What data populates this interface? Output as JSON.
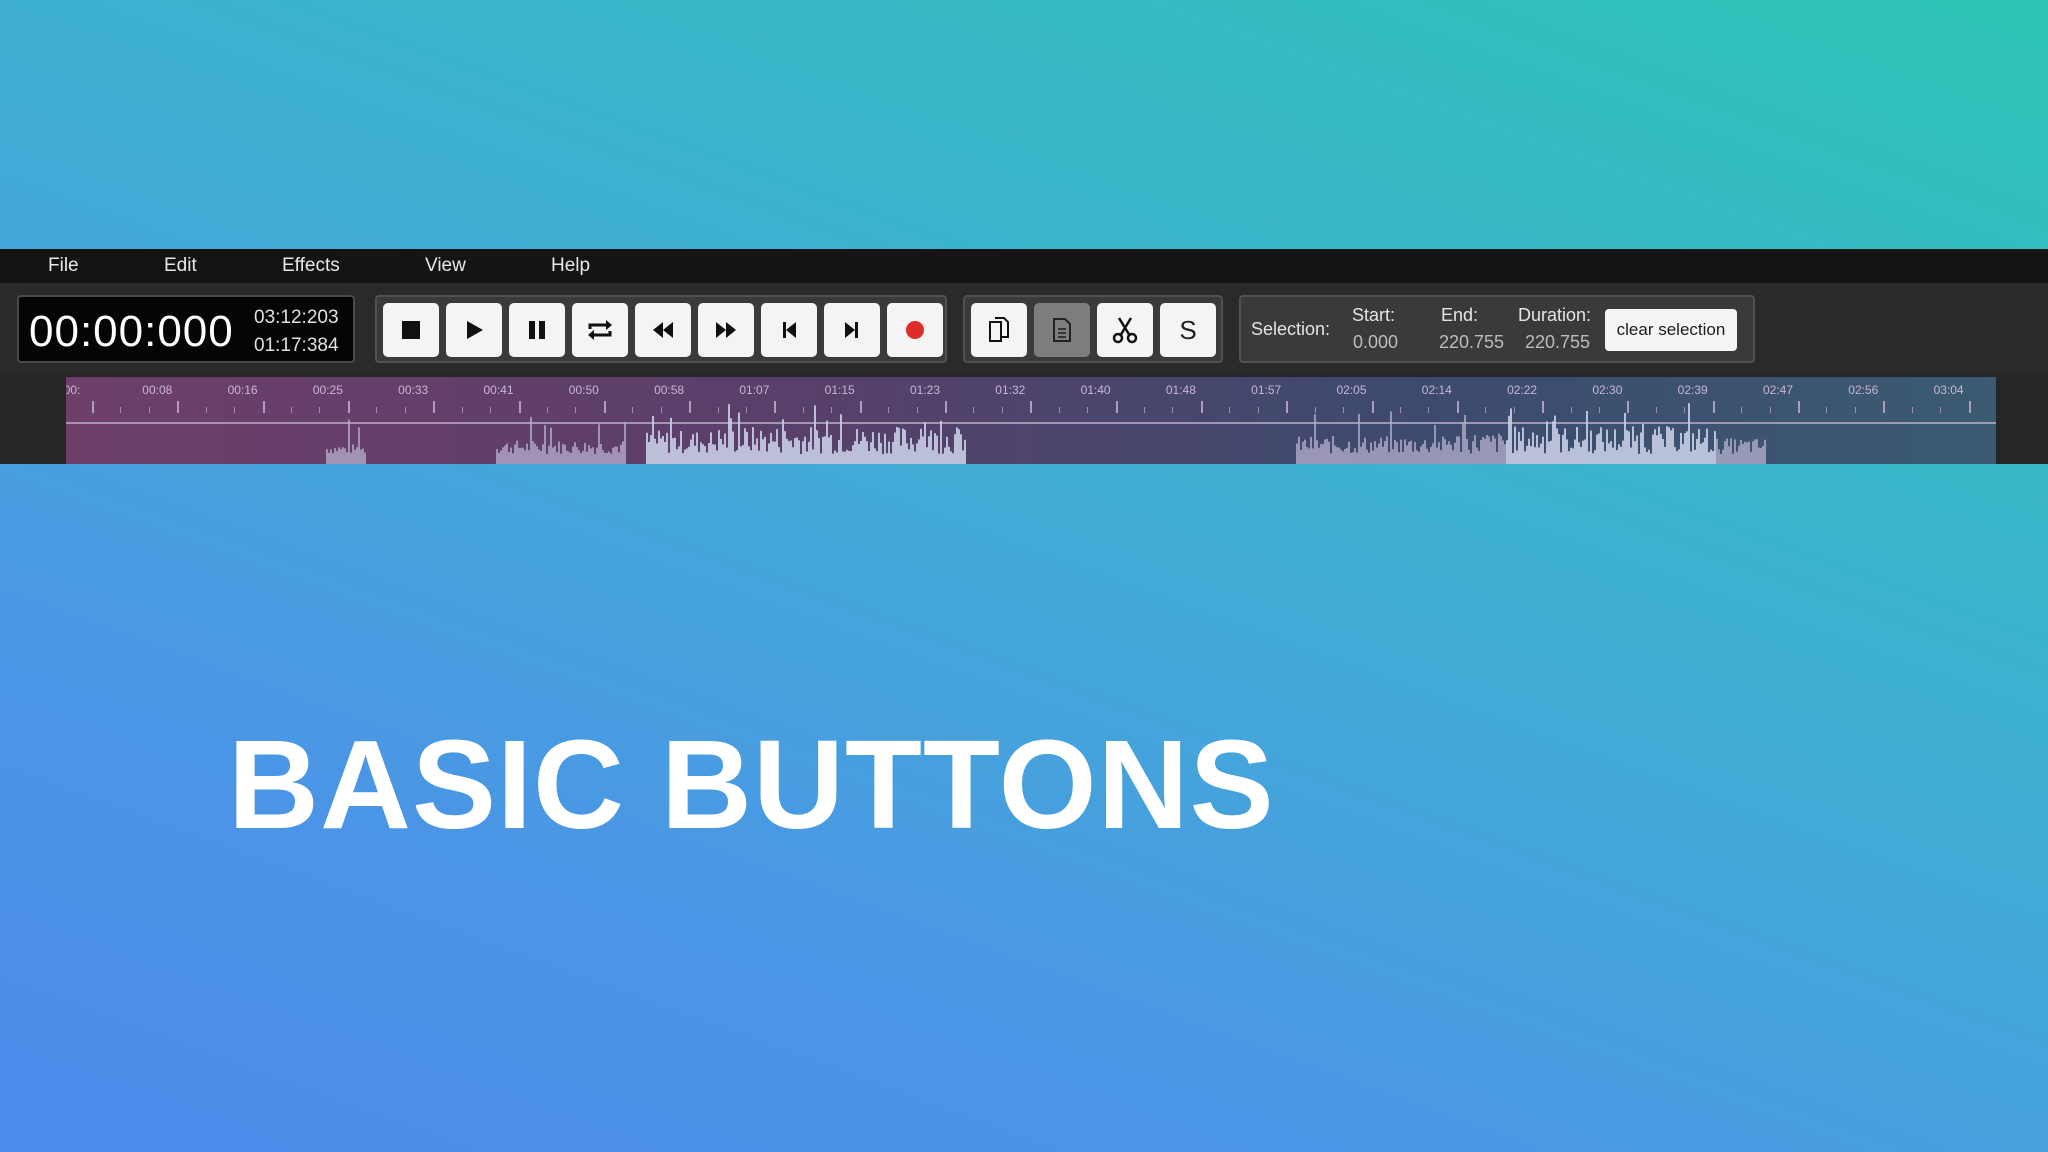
{
  "menu": [
    "File",
    "Edit",
    "Effects",
    "View",
    "Help"
  ],
  "time": {
    "current": "00:00:000",
    "total": "03:12:203",
    "selection": "01:17:384"
  },
  "transport_buttons": [
    {
      "name": "stop-button",
      "icon": "stop-icon"
    },
    {
      "name": "play-button",
      "icon": "play-icon"
    },
    {
      "name": "pause-button",
      "icon": "pause-icon"
    },
    {
      "name": "loop-button",
      "icon": "loop-icon"
    },
    {
      "name": "rewind-button",
      "icon": "rewind-icon"
    },
    {
      "name": "fast-forward-button",
      "icon": "fast-forward-icon"
    },
    {
      "name": "skip-to-start-button",
      "icon": "skip-back-icon"
    },
    {
      "name": "skip-to-end-button",
      "icon": "skip-forward-icon"
    },
    {
      "name": "record-button",
      "icon": "record-icon"
    }
  ],
  "edit_buttons": {
    "copy": "copy-icon",
    "paste": "paste-icon",
    "cut": "scissors-icon",
    "silence_label": "S"
  },
  "selection": {
    "label": "Selection:",
    "start_label": "Start:",
    "start_value": "0.000",
    "end_label": "End:",
    "end_value": "220.755",
    "duration_label": "Duration:",
    "duration_value": "220.755",
    "clear_label": "clear selection"
  },
  "timeline": {
    "ticks": [
      "00:",
      "00:08",
      "00:16",
      "00:25",
      "00:33",
      "00:41",
      "00:50",
      "00:58",
      "01:07",
      "01:15",
      "01:23",
      "01:32",
      "01:40",
      "01:48",
      "01:57",
      "02:05",
      "02:14",
      "02:22",
      "02:30",
      "02:39",
      "02:47",
      "02:56",
      "03:04"
    ]
  },
  "colors": {
    "record": "#e02b2b",
    "accent_gradient_start": "#2ec4b6",
    "accent_gradient_end": "#4c8cec"
  },
  "title": "BASIC BUTTONS"
}
